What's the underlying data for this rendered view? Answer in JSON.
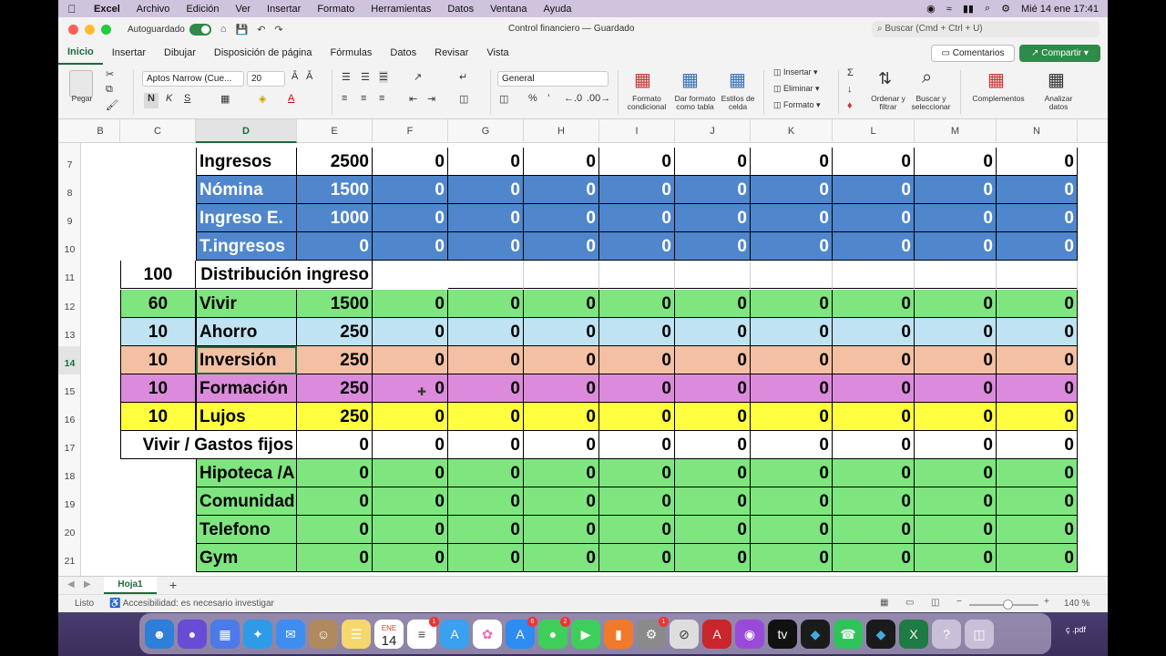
{
  "menubar": {
    "app": "Excel",
    "items": [
      "Archivo",
      "Edición",
      "Ver",
      "Insertar",
      "Formato",
      "Herramientas",
      "Datos",
      "Ventana",
      "Ayuda"
    ],
    "datetime": "Mié 14 ene  17:41"
  },
  "titlebar": {
    "autosave": "Autoguardado",
    "doc_title": "Control financiero — Guardado",
    "search_placeholder": "Buscar (Cmd + Ctrl + U)"
  },
  "ribbon_tabs": [
    "Inicio",
    "Insertar",
    "Dibujar",
    "Disposición de página",
    "Fórmulas",
    "Datos",
    "Revisar",
    "Vista"
  ],
  "buttons": {
    "comments": "Comentarios",
    "share": "Compartir"
  },
  "ribbon": {
    "paste": "Pegar",
    "font_name": "Aptos Narrow (Cue...",
    "font_size": "20",
    "number_format": "General",
    "cond_format": "Formato condicional",
    "table_format": "Dar formato como tabla",
    "cell_styles": "Estilos de celda",
    "insert": "Insertar",
    "delete": "Eliminar",
    "format": "Formato",
    "sort_filter": "Ordenar y filtrar",
    "find_select": "Buscar y seleccionar",
    "addins": "Complementos",
    "analyze": "Analizar datos",
    "bold": "N",
    "italic": "K",
    "underline": "S"
  },
  "columns": [
    "B",
    "C",
    "D",
    "E",
    "F",
    "G",
    "H",
    "I",
    "J",
    "K",
    "L",
    "M",
    "N"
  ],
  "selected_column": "D",
  "rows": [
    7,
    8,
    9,
    10,
    11,
    12,
    13,
    14,
    15,
    16,
    17,
    18,
    19,
    20,
    21
  ],
  "selected_row": 14,
  "sheet": {
    "r7": {
      "d": "Ingresos",
      "e": "2500",
      "rest": "0"
    },
    "r8": {
      "d": "Nómina",
      "e": "1500",
      "rest": "0"
    },
    "r9": {
      "d": "Ingreso E.",
      "e": "1000",
      "rest": "0"
    },
    "r10": {
      "d": "T.ingresos",
      "e": "0",
      "rest": "0"
    },
    "r11": {
      "c": "100",
      "title": "Distribución ingreso"
    },
    "r12": {
      "c": "60",
      "d": "Vivir",
      "e": "1500",
      "rest": "0"
    },
    "r13": {
      "c": "10",
      "d": "Ahorro",
      "e": "250",
      "rest": "0"
    },
    "r14": {
      "c": "10",
      "d": "Inversión",
      "e": "250",
      "rest": "0"
    },
    "r15": {
      "c": "10",
      "d": "Formación",
      "e": "250",
      "rest": "0"
    },
    "r16": {
      "c": "10",
      "d": "Lujos",
      "e": "250",
      "rest": "0"
    },
    "r17": {
      "cd": "Vivir / Gastos fijos",
      "e": "0",
      "rest": "0"
    },
    "r18": {
      "d": "Hipoteca /A",
      "e": "0",
      "rest": "0"
    },
    "r19": {
      "d": "Comunidad",
      "e": "0",
      "rest": "0"
    },
    "r20": {
      "d": "Telefono",
      "e": "0",
      "rest": "0"
    },
    "r21": {
      "d": "Gym",
      "e": "0",
      "rest": "0"
    }
  },
  "colors": {
    "blue": "#4f86cc",
    "green": "#7fe57f",
    "lightblue": "#bfe3f2",
    "salmon": "#f3c0a3",
    "purple": "#dc8bdc",
    "yellow": "#ffff3f"
  },
  "sheet_tab": "Hoja1",
  "status": {
    "ready": "Listo",
    "accessibility": "Accesibilidad: es necesario investigar",
    "zoom": "140 %"
  },
  "dock": {
    "calendar_month": "ENE",
    "calendar_day": "14",
    "tail_text": "ç .pdf"
  }
}
